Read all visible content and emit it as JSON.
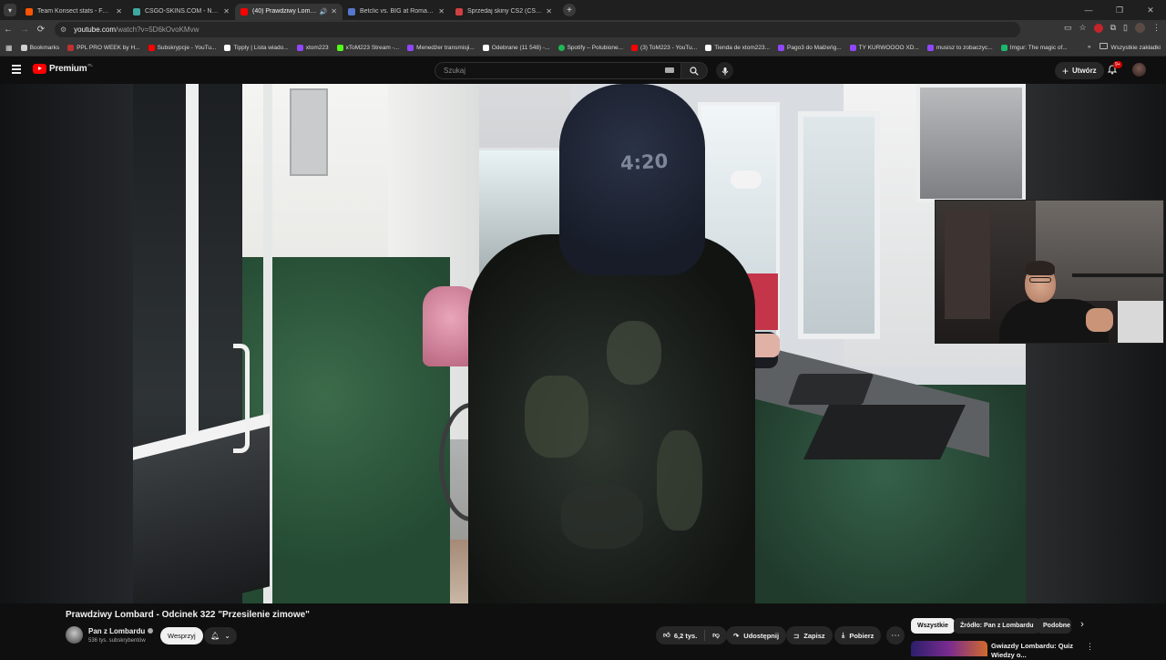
{
  "browser": {
    "tabs": [
      {
        "title": "Team Konsect stats - FACEIT.com",
        "favicon_color": "#ff5500",
        "active": false
      },
      {
        "title": "CSGO-SKINS.COM - Najlepsze",
        "favicon_color": "#3fa8a0",
        "active": false
      },
      {
        "title": "(40) Prawdziwy Lombard - O",
        "favicon_color": "#ff0000",
        "active": true,
        "audio": true
      },
      {
        "title": "Betclic vs. BIG at Roman Imperi",
        "favicon_color": "#5577cc",
        "active": false
      },
      {
        "title": "Sprzedaj skiny CS2 (CS:GO) | N",
        "favicon_color": "#d04040",
        "active": false
      }
    ],
    "url_host": "youtube.com",
    "url_path": "/watch?v=5D6kOvoKMvw",
    "bookmarks": [
      {
        "label": "Bookmarks",
        "color": "#d0d0d0"
      },
      {
        "label": "PPL PRO WEEK by H...",
        "color": "#c03030"
      },
      {
        "label": "Subskrypcje - YouTu...",
        "color": "#ff0000"
      },
      {
        "label": "Tipply | Lista wiado...",
        "color": "#ffffff"
      },
      {
        "label": "xtom223",
        "color": "#9146ff"
      },
      {
        "label": "xToM223 Stream -...",
        "color": "#53fc18"
      },
      {
        "label": "Menedżer transmisji...",
        "color": "#9146ff"
      },
      {
        "label": "Odebrane (11 548) -...",
        "color": "#ffffff"
      },
      {
        "label": "Spotify – Polubione...",
        "color": "#1db954"
      },
      {
        "label": "(3) ToM223 - YouTu...",
        "color": "#ff0000"
      },
      {
        "label": "Tienda de xtom223...",
        "color": "#ffffff"
      },
      {
        "label": "Pago3 do Małżeńg...",
        "color": "#9146ff"
      },
      {
        "label": "TY KURWOOOO XD...",
        "color": "#9146ff"
      },
      {
        "label": "musisz to zobaczyc...",
        "color": "#9146ff"
      },
      {
        "label": "Imgur: The magic of...",
        "color": "#1bb76e"
      }
    ],
    "bookmarks_more": "»",
    "all_bookmarks": "Wszystkie zakładki"
  },
  "youtube": {
    "logo_word": "Premium",
    "logo_region": "PL",
    "search_placeholder": "Szukaj",
    "create_label": "Utwórz",
    "notifications_badge": "9+"
  },
  "video": {
    "title": "Prawdziwy Lombard - Odcinek 322 \"Przesilenie zimowe\"",
    "hoodie_text": "4:20",
    "channel_name": "Pan z Lombardu",
    "subscribers": "536 tys. subskrybentów",
    "support_label": "Wesprzyj",
    "likes": "6,2 tys.",
    "share_label": "Udostępnij",
    "save_label": "Zapisz",
    "download_label": "Pobierz"
  },
  "sidebar": {
    "chips": [
      "Wszystkie",
      "Źródło: Pan z Lombardu",
      "Podobne"
    ],
    "rec_title": "Gwiazdy Lombardu: Quiz Wiedzy o..."
  }
}
